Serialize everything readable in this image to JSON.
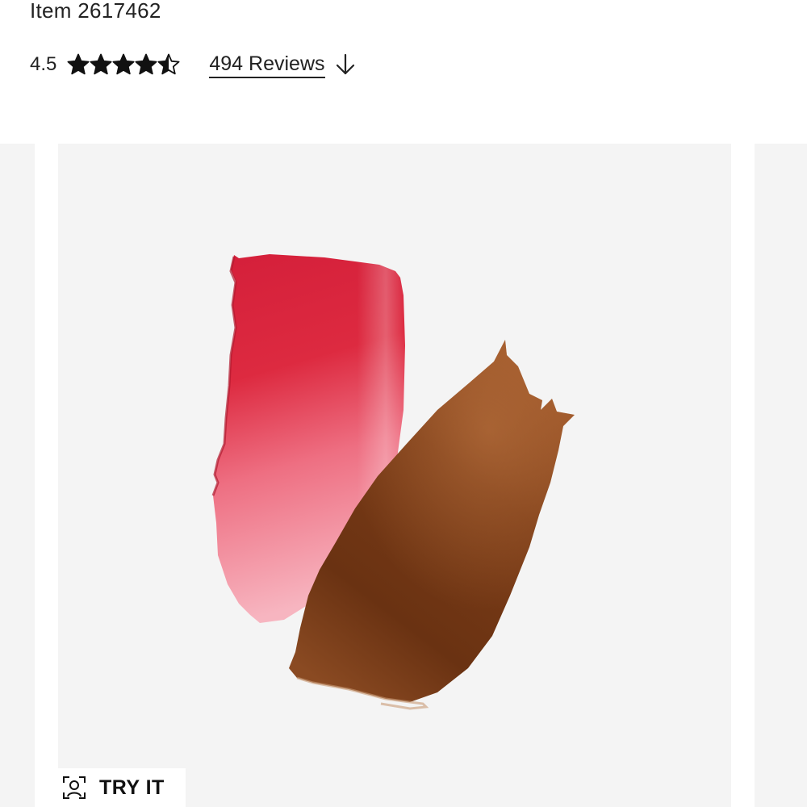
{
  "product": {
    "item_number": "Item 2617462"
  },
  "rating": {
    "value_label": "4.5",
    "value": 4.5,
    "max": 5,
    "star_color": "#111111",
    "reviews_label": "494 Reviews",
    "arrow_icon": "arrow-down-icon"
  },
  "gallery": {
    "background": "#f4f4f4",
    "swatches": [
      {
        "name": "red-pink swatch",
        "color": "#d9263d"
      },
      {
        "name": "brown swatch",
        "color": "#7a3a16"
      }
    ]
  },
  "try_on": {
    "label": "TRY IT",
    "icon": "face-scan-icon"
  }
}
